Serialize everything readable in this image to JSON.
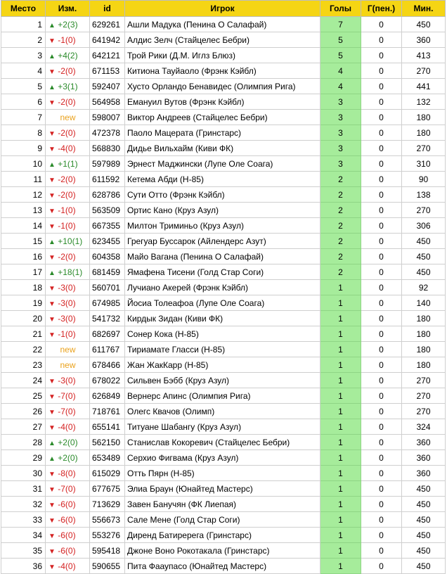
{
  "columns": [
    "Место",
    "Изм.",
    "id",
    "Игрок",
    "Голы",
    "Г(пен.)",
    "Мин."
  ],
  "colors": {
    "header_bg": "#f5d514",
    "goals_bg": "#a6ec9b",
    "up": "#2a8a2a",
    "down": "#d42121",
    "new": "#eaa21d"
  },
  "rows": [
    {
      "rank": "1",
      "dir": "up",
      "change": "+2(3)",
      "id": "629261",
      "player": "Ашли Мадука (Пенина О Салафай)",
      "goals": "7",
      "pen": "0",
      "min": "450"
    },
    {
      "rank": "2",
      "dir": "down",
      "change": "-1(0)",
      "id": "641942",
      "player": "Алдис Зелч (Стайцелес Бебри)",
      "goals": "5",
      "pen": "0",
      "min": "360"
    },
    {
      "rank": "3",
      "dir": "up",
      "change": "+4(2)",
      "id": "642121",
      "player": "Трой Рики (Д.М. Иглз Блюз)",
      "goals": "5",
      "pen": "0",
      "min": "413"
    },
    {
      "rank": "4",
      "dir": "down",
      "change": "-2(0)",
      "id": "671153",
      "player": "Китиона Тауйаоло (Фрэнк Кэйбл)",
      "goals": "4",
      "pen": "0",
      "min": "270"
    },
    {
      "rank": "5",
      "dir": "up",
      "change": "+3(1)",
      "id": "592407",
      "player": "Хусто Орландо Бенавидес (Олимпия Рига)",
      "goals": "4",
      "pen": "0",
      "min": "441"
    },
    {
      "rank": "6",
      "dir": "down",
      "change": "-2(0)",
      "id": "564958",
      "player": "Емануил Вутов (Фрэнк Кэйбл)",
      "goals": "3",
      "pen": "0",
      "min": "132"
    },
    {
      "rank": "7",
      "dir": "new",
      "change": "new",
      "id": "598007",
      "player": "Виктор Андреев (Стайцелес Бебри)",
      "goals": "3",
      "pen": "0",
      "min": "180"
    },
    {
      "rank": "8",
      "dir": "down",
      "change": "-2(0)",
      "id": "472378",
      "player": "Паоло Мацерата (Гринстарс)",
      "goals": "3",
      "pen": "0",
      "min": "180"
    },
    {
      "rank": "9",
      "dir": "down",
      "change": "-4(0)",
      "id": "568830",
      "player": "Дидье Вильхайм (Киви ФК)",
      "goals": "3",
      "pen": "0",
      "min": "270"
    },
    {
      "rank": "10",
      "dir": "up",
      "change": "+1(1)",
      "id": "597989",
      "player": "Эрнест Маджински (Лупе Оле Соага)",
      "goals": "3",
      "pen": "0",
      "min": "310"
    },
    {
      "rank": "11",
      "dir": "down",
      "change": "-2(0)",
      "id": "611592",
      "player": "Кетема Абди (Н-85)",
      "goals": "2",
      "pen": "0",
      "min": "90"
    },
    {
      "rank": "12",
      "dir": "down",
      "change": "-2(0)",
      "id": "628786",
      "player": "Сути Отто (Фрэнк Кэйбл)",
      "goals": "2",
      "pen": "0",
      "min": "138"
    },
    {
      "rank": "13",
      "dir": "down",
      "change": "-1(0)",
      "id": "563509",
      "player": "Ортис Кано (Круз Азул)",
      "goals": "2",
      "pen": "0",
      "min": "270"
    },
    {
      "rank": "14",
      "dir": "down",
      "change": "-1(0)",
      "id": "667355",
      "player": "Милтон Триминьо (Круз Азул)",
      "goals": "2",
      "pen": "0",
      "min": "306"
    },
    {
      "rank": "15",
      "dir": "up",
      "change": "+10(1)",
      "id": "623455",
      "player": "Грегуар Буссарок (Айлендерс Азут)",
      "goals": "2",
      "pen": "0",
      "min": "450"
    },
    {
      "rank": "16",
      "dir": "down",
      "change": "-2(0)",
      "id": "604358",
      "player": "Майо Вагана (Пенина О Салафай)",
      "goals": "2",
      "pen": "0",
      "min": "450"
    },
    {
      "rank": "17",
      "dir": "up",
      "change": "+18(1)",
      "id": "681459",
      "player": "Ямафена Тисени (Голд Стар Соги)",
      "goals": "2",
      "pen": "0",
      "min": "450"
    },
    {
      "rank": "18",
      "dir": "down",
      "change": "-3(0)",
      "id": "560701",
      "player": "Лучиано Акерей (Фрэнк Кэйбл)",
      "goals": "1",
      "pen": "0",
      "min": "92"
    },
    {
      "rank": "19",
      "dir": "down",
      "change": "-3(0)",
      "id": "674985",
      "player": "Йосиа Толеафоа (Лупе Оле Соага)",
      "goals": "1",
      "pen": "0",
      "min": "140"
    },
    {
      "rank": "20",
      "dir": "down",
      "change": "-3(0)",
      "id": "541732",
      "player": "Кирдык Зидан (Киви ФК)",
      "goals": "1",
      "pen": "0",
      "min": "180"
    },
    {
      "rank": "21",
      "dir": "down",
      "change": "-1(0)",
      "id": "682697",
      "player": "Сонер Кока (Н-85)",
      "goals": "1",
      "pen": "0",
      "min": "180"
    },
    {
      "rank": "22",
      "dir": "new",
      "change": "new",
      "id": "611767",
      "player": "Тириамате Гласси (Н-85)",
      "goals": "1",
      "pen": "0",
      "min": "180"
    },
    {
      "rank": "23",
      "dir": "new",
      "change": "new",
      "id": "678466",
      "player": "Жан ЖакКарр (Н-85)",
      "goals": "1",
      "pen": "0",
      "min": "180"
    },
    {
      "rank": "24",
      "dir": "down",
      "change": "-3(0)",
      "id": "678022",
      "player": "Сильвен Бэбб (Круз Азул)",
      "goals": "1",
      "pen": "0",
      "min": "270"
    },
    {
      "rank": "25",
      "dir": "down",
      "change": "-7(0)",
      "id": "626849",
      "player": "Вернерс Апинс (Олимпия Рига)",
      "goals": "1",
      "pen": "0",
      "min": "270"
    },
    {
      "rank": "26",
      "dir": "down",
      "change": "-7(0)",
      "id": "718761",
      "player": "Олегс Квачов (Олимп)",
      "goals": "1",
      "pen": "0",
      "min": "270"
    },
    {
      "rank": "27",
      "dir": "down",
      "change": "-4(0)",
      "id": "655141",
      "player": "Титуане Шабангу (Круз Азул)",
      "goals": "1",
      "pen": "0",
      "min": "324"
    },
    {
      "rank": "28",
      "dir": "up",
      "change": "+2(0)",
      "id": "562150",
      "player": "Станислав Кокоревич (Стайцелес Бебри)",
      "goals": "1",
      "pen": "0",
      "min": "360"
    },
    {
      "rank": "29",
      "dir": "up",
      "change": "+2(0)",
      "id": "653489",
      "player": "Серхио Фигвама (Круз Азул)",
      "goals": "1",
      "pen": "0",
      "min": "360"
    },
    {
      "rank": "30",
      "dir": "down",
      "change": "-8(0)",
      "id": "615029",
      "player": "Отть Пярн (Н-85)",
      "goals": "1",
      "pen": "0",
      "min": "360"
    },
    {
      "rank": "31",
      "dir": "down",
      "change": "-7(0)",
      "id": "677675",
      "player": "Элиа Браун (Юнайтед Мастерс)",
      "goals": "1",
      "pen": "0",
      "min": "450"
    },
    {
      "rank": "32",
      "dir": "down",
      "change": "-6(0)",
      "id": "713629",
      "player": "Завен Банучян (ФК Лиепая)",
      "goals": "1",
      "pen": "0",
      "min": "450"
    },
    {
      "rank": "33",
      "dir": "down",
      "change": "-6(0)",
      "id": "556673",
      "player": "Сале Мене (Голд Стар Соги)",
      "goals": "1",
      "pen": "0",
      "min": "450"
    },
    {
      "rank": "34",
      "dir": "down",
      "change": "-6(0)",
      "id": "553276",
      "player": "Диренд Батиререга (Гринстарс)",
      "goals": "1",
      "pen": "0",
      "min": "450"
    },
    {
      "rank": "35",
      "dir": "down",
      "change": "-6(0)",
      "id": "595418",
      "player": "Джоне Воно Рокотакала (Гринстарс)",
      "goals": "1",
      "pen": "0",
      "min": "450"
    },
    {
      "rank": "36",
      "dir": "down",
      "change": "-4(0)",
      "id": "590655",
      "player": "Пита Фааупасо (Юнайтед Мастерс)",
      "goals": "1",
      "pen": "0",
      "min": "450"
    }
  ]
}
